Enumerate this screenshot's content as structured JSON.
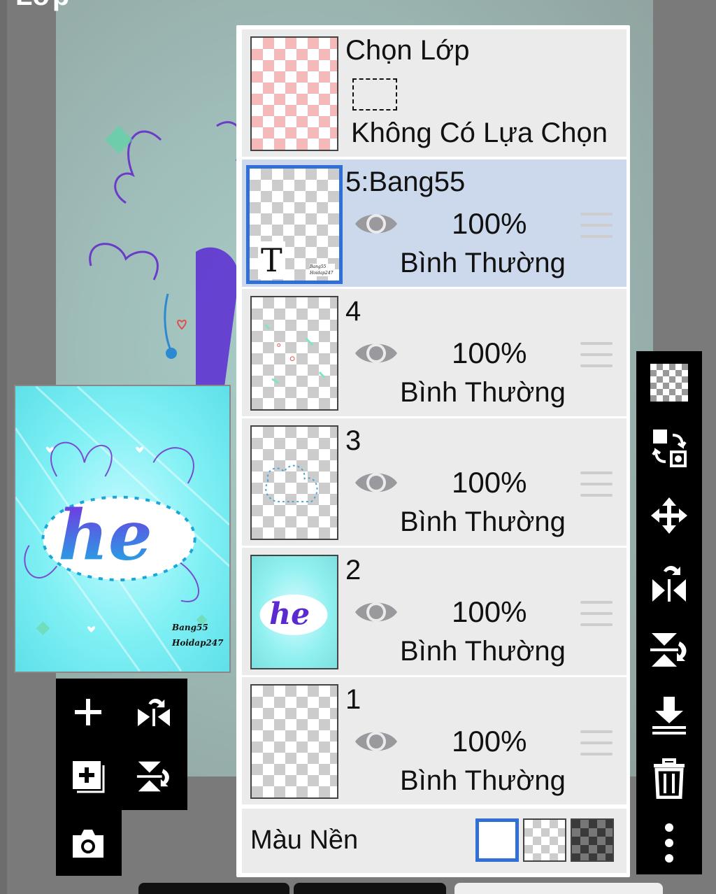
{
  "screen_title": "Lớp",
  "selection": {
    "title": "Chọn Lớp",
    "status": "Không Có Lựa Chọn"
  },
  "layers": [
    {
      "name": "5:Bang55",
      "opacity": "100%",
      "blend": "Bình Thường",
      "active": true
    },
    {
      "name": "4",
      "opacity": "100%",
      "blend": "Bình Thường",
      "active": false
    },
    {
      "name": "3",
      "opacity": "100%",
      "blend": "Bình Thường",
      "active": false
    },
    {
      "name": "2",
      "opacity": "100%",
      "blend": "Bình Thường",
      "active": false
    },
    {
      "name": "1",
      "opacity": "100%",
      "blend": "Bình Thường",
      "active": false
    }
  ],
  "background": {
    "label": "Màu Nền",
    "options": [
      "white",
      "transparent",
      "dark-checker"
    ],
    "selected": "white"
  },
  "preview": {
    "art_text": "he",
    "watermark_line1": "Bang55",
    "watermark_line2": "Hoidap247"
  },
  "layer5_thumb": {
    "glyph": "T",
    "watermark_line1": "Bang55",
    "watermark_line2": "Hoidap247"
  },
  "right_toolbar": [
    "transparency-checker-icon",
    "layer-swap-icon",
    "move-icon",
    "flip-horizontal-icon",
    "flip-vertical-icon",
    "merge-down-icon",
    "trash-icon",
    "more-icon"
  ],
  "left_toolbar": [
    "add-layer-icon",
    "flip-horizontal-icon",
    "add-copy-layer-icon",
    "flip-vertical-icon",
    "camera-icon"
  ],
  "colors": {
    "accent": "#2f6fd6",
    "active_row": "#ccd9ec",
    "row": "#ebebeb"
  }
}
